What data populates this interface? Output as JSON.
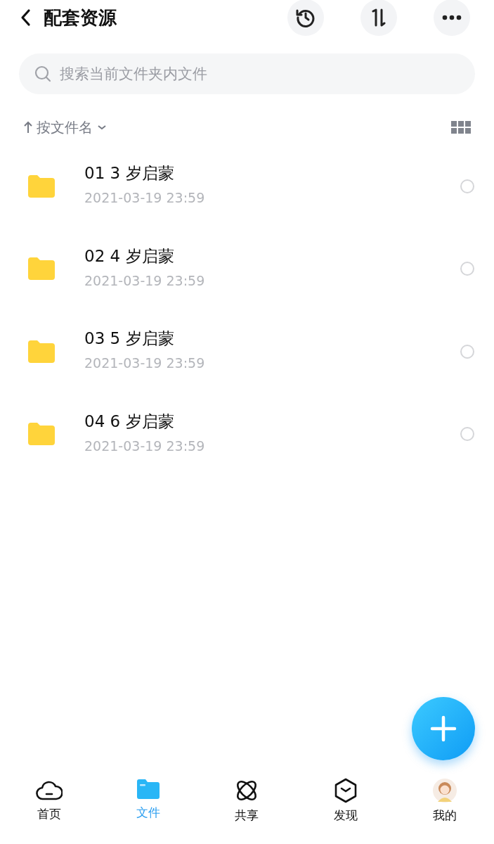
{
  "header": {
    "title": "配套资源"
  },
  "search": {
    "placeholder": "搜索当前文件夹内文件"
  },
  "sort": {
    "label": "按文件名"
  },
  "files": [
    {
      "name": "01 3 岁启蒙",
      "date": "2021-03-19 23:59",
      "selected": false
    },
    {
      "name": "02 4 岁启蒙",
      "date": "2021-03-19 23:59",
      "selected": false
    },
    {
      "name": "03 5 岁启蒙",
      "date": "2021-03-19 23:59",
      "selected": false
    },
    {
      "name": "04 6 岁启蒙",
      "date": "2021-03-19 23:59",
      "selected": false
    }
  ],
  "tabs": [
    {
      "label": "首页",
      "kind": "home",
      "selected": false
    },
    {
      "label": "文件",
      "kind": "files",
      "selected": true
    },
    {
      "label": "共享",
      "kind": "share",
      "selected": false
    },
    {
      "label": "发现",
      "kind": "discover",
      "selected": false
    },
    {
      "label": "我的",
      "kind": "me",
      "selected": false
    }
  ]
}
